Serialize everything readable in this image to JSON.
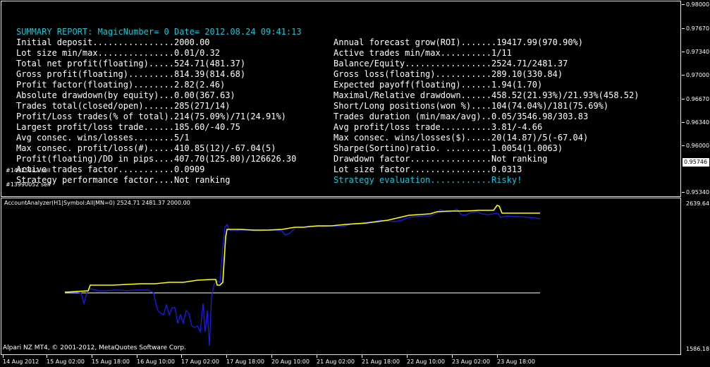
{
  "report": {
    "title": "SUMMARY REPORT: MagicNumber= 0 Date= 2012.08.24 09:41:13",
    "left_rows": [
      "Initial deposit................2000.00",
      "Lot size min/max...............0.01/0.32",
      "Total net profit(floating).....524.71(481.37)",
      "Gross profit(floating).........814.39(814.68)",
      "Profit factor(floating)........2.82(2.46)",
      "Absolute drawdown(by equity)...0.00(367.63)",
      "Trades total(closed/open)......285(271/14)",
      "Profit/Loss trades(% of total).214(75.09%)/71(24.91%)",
      "Largest profit/loss trade......185.60/-40.75",
      "Avg consec. wins/losses........5/1",
      "Max consec. profit/loss(#).....410.85(12)/-67.04(5)",
      "Profit(floating)/DD in pips....407.70(125.80)/126626.30",
      "Active trades factor...........0.0909",
      "Strategy performance factor....Not ranking"
    ],
    "right_rows": [
      "Annual forecast grow(ROI).......19417.99(970.90%)",
      "Active trades min/max..........1/11",
      "Balance/Equity.................2524.71/2481.37",
      "Gross loss(floating)...........289.10(330.84)",
      "Expected payoff(floating)......1.94(1.70)",
      "Maximal/Relative drawdown......458.52(21.93%)/21.93%(458.52)",
      "Short/Long positions(won %)....104(74.04%)/181(75.69%)",
      "Trades duration (min/max/avg)..0.05/3546.98/303.83",
      "Avg profit/loss trade..........3.81/-4.66",
      "Max consec. wins/losses($).....20(14.87)/5(-67.04)",
      "Sharpe(Sortino)ratio. .........1.0054(1.0063)",
      "Drawdown factor................Not ranking",
      "Lot size factor................0.0313",
      "Strategy evaluation............Risky!"
    ]
  },
  "order_labels": [
    "#14925442 sell",
    "#13990052 sell"
  ],
  "price_axis": {
    "labels": [
      "0.98000",
      "0.97670",
      "0.97340",
      "0.97000",
      "0.96670",
      "0.96340",
      "0.96000",
      "0.95340"
    ],
    "current_price": "0.95746"
  },
  "indicator": {
    "label": "AccountAnalyzer(H1|Symbol:All|MN=0) 2524.71 2481.37 2000.00",
    "axis_top": "2639.64",
    "axis_bottom": "1586.18"
  },
  "copyright": "Alpari NZ MT4, © 2001-2012, MetaQuotes Software Corp.",
  "time_axis": [
    "14 Aug 2012",
    "15 Aug 02:00",
    "15 Aug 18:00",
    "16 Aug 10:00",
    "17 Aug 02:00",
    "17 Aug 18:00",
    "20 Aug 10:00",
    "21 Aug 02:00",
    "21 Aug 18:00",
    "22 Aug 10:00",
    "23 Aug 02:00",
    "23 Aug 18:00"
  ],
  "colors": {
    "background": "#000000",
    "report_title": "#19c3d3",
    "balance_line": "#ffff00",
    "equity_line": "#0000ff",
    "baseline": "#ffffff"
  }
}
